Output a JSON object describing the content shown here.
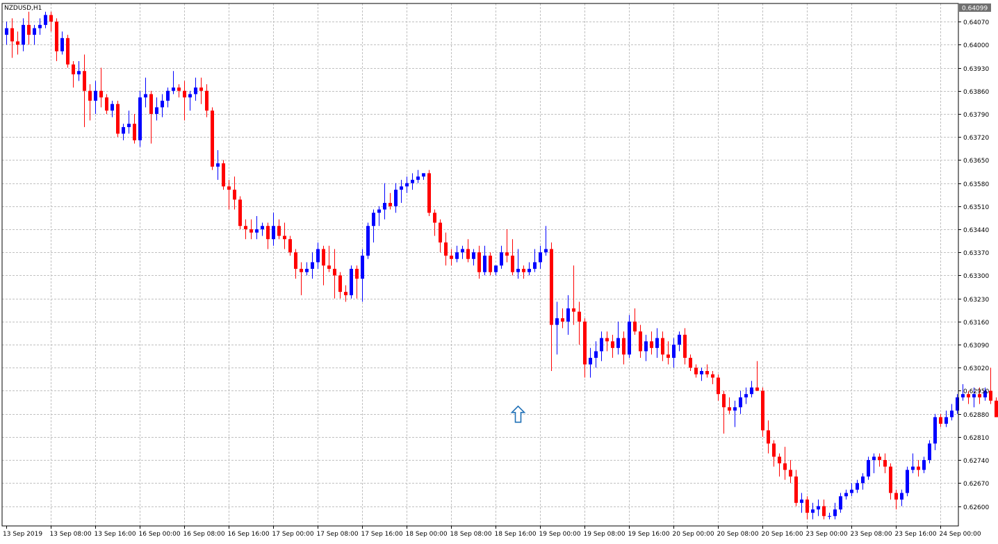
{
  "symbol_label": "NZDUSD,H1",
  "colors": {
    "bull": "#0000ff",
    "bear": "#ff0000",
    "grid": "#c0c0c0",
    "frame": "#000000",
    "background": "#ffffff",
    "price_tag_bg": "#707070",
    "arrow": "#1e6fb6"
  },
  "current_price_label": "0.64099",
  "arrow_icon": "up-arrow-icon",
  "chart_data": {
    "type": "candlestick",
    "symbol": "NZDUSD",
    "timeframe": "H1",
    "ylim": [
      0.6254,
      0.64125
    ],
    "grid": true,
    "y_ticks": [
      0.6407,
      0.64,
      0.6393,
      0.6386,
      0.6379,
      0.6372,
      0.6365,
      0.6358,
      0.6351,
      0.6344,
      0.6337,
      0.633,
      0.6323,
      0.6316,
      0.6309,
      0.6302,
      0.6295,
      0.6288,
      0.6281,
      0.6274,
      0.6267,
      0.626
    ],
    "y_tick_labels": [
      "0.64070",
      "0.64000",
      "0.63930",
      "0.63860",
      "0.63790",
      "0.63720",
      "0.63650",
      "0.63580",
      "0.63510",
      "0.63440",
      "0.63370",
      "0.63300",
      "0.63230",
      "0.63160",
      "0.63090",
      "0.63020",
      "0.62950",
      "0.62880",
      "0.62810",
      "0.62740",
      "0.62670",
      "0.62600"
    ],
    "x_tick_labels": [
      {
        "bar": 0,
        "label": "13 Sep 2019"
      },
      {
        "bar": 8,
        "label": "13 Sep 08:00"
      },
      {
        "bar": 16,
        "label": "13 Sep 16:00"
      },
      {
        "bar": 24,
        "label": "16 Sep 00:00"
      },
      {
        "bar": 32,
        "label": "16 Sep 08:00"
      },
      {
        "bar": 40,
        "label": "16 Sep 16:00"
      },
      {
        "bar": 48,
        "label": "17 Sep 00:00"
      },
      {
        "bar": 56,
        "label": "17 Sep 08:00"
      },
      {
        "bar": 64,
        "label": "17 Sep 16:00"
      },
      {
        "bar": 72,
        "label": "18 Sep 00:00"
      },
      {
        "bar": 80,
        "label": "18 Sep 08:00"
      },
      {
        "bar": 88,
        "label": "18 Sep 16:00"
      },
      {
        "bar": 96,
        "label": "19 Sep 00:00"
      },
      {
        "bar": 104,
        "label": "19 Sep 08:00"
      },
      {
        "bar": 112,
        "label": "19 Sep 16:00"
      },
      {
        "bar": 120,
        "label": "20 Sep 00:00"
      },
      {
        "bar": 128,
        "label": "20 Sep 08:00"
      },
      {
        "bar": 136,
        "label": "20 Sep 16:00"
      },
      {
        "bar": 144,
        "label": "23 Sep 00:00"
      },
      {
        "bar": 152,
        "label": "23 Sep 08:00"
      },
      {
        "bar": 160,
        "label": "23 Sep 16:00"
      },
      {
        "bar": 168,
        "label": "24 Sep 00:00"
      }
    ],
    "arrow_bar": 92,
    "arrow_price": 0.6288,
    "ohlc": [
      [
        0.6403,
        0.6407,
        0.64,
        0.6405
      ],
      [
        0.6405,
        0.6408,
        0.6396,
        0.6401
      ],
      [
        0.6401,
        0.6404,
        0.6397,
        0.64
      ],
      [
        0.64,
        0.6408,
        0.6398,
        0.6406
      ],
      [
        0.6406,
        0.641,
        0.64,
        0.6403
      ],
      [
        0.6403,
        0.6406,
        0.64,
        0.6405
      ],
      [
        0.6405,
        0.6408,
        0.6403,
        0.6406
      ],
      [
        0.6406,
        0.641,
        0.6405,
        0.6409
      ],
      [
        0.6409,
        0.641,
        0.6404,
        0.6407
      ],
      [
        0.6407,
        0.6408,
        0.6395,
        0.6398
      ],
      [
        0.6398,
        0.6404,
        0.6397,
        0.6402
      ],
      [
        0.6402,
        0.6403,
        0.6393,
        0.6394
      ],
      [
        0.6394,
        0.6395,
        0.6387,
        0.6391
      ],
      [
        0.6391,
        0.6395,
        0.6389,
        0.6392
      ],
      [
        0.6392,
        0.6397,
        0.6375,
        0.6386
      ],
      [
        0.6386,
        0.6388,
        0.6377,
        0.6383
      ],
      [
        0.6383,
        0.6389,
        0.6379,
        0.6386
      ],
      [
        0.6386,
        0.6393,
        0.6381,
        0.6384
      ],
      [
        0.6384,
        0.6385,
        0.6379,
        0.638
      ],
      [
        0.638,
        0.6383,
        0.6378,
        0.6382
      ],
      [
        0.6382,
        0.6383,
        0.6372,
        0.6373
      ],
      [
        0.6373,
        0.6376,
        0.6371,
        0.6375
      ],
      [
        0.6375,
        0.638,
        0.6373,
        0.6376
      ],
      [
        0.6376,
        0.6379,
        0.637,
        0.6371
      ],
      [
        0.6371,
        0.6386,
        0.6369,
        0.6384
      ],
      [
        0.6384,
        0.639,
        0.6381,
        0.6385
      ],
      [
        0.6385,
        0.6386,
        0.637,
        0.6379
      ],
      [
        0.6379,
        0.6384,
        0.6377,
        0.6381
      ],
      [
        0.6381,
        0.6385,
        0.6378,
        0.6383
      ],
      [
        0.6383,
        0.6387,
        0.6381,
        0.6386
      ],
      [
        0.6386,
        0.6392,
        0.6385,
        0.6387
      ],
      [
        0.6387,
        0.6388,
        0.6384,
        0.6386
      ],
      [
        0.6386,
        0.6389,
        0.6377,
        0.6384
      ],
      [
        0.6384,
        0.6386,
        0.638,
        0.6385
      ],
      [
        0.6385,
        0.639,
        0.6383,
        0.6387
      ],
      [
        0.6387,
        0.639,
        0.6382,
        0.6386
      ],
      [
        0.6386,
        0.6388,
        0.6378,
        0.638
      ],
      [
        0.638,
        0.6381,
        0.6362,
        0.6363
      ],
      [
        0.6363,
        0.6368,
        0.6359,
        0.6364
      ],
      [
        0.6364,
        0.6365,
        0.6356,
        0.6357
      ],
      [
        0.6357,
        0.6359,
        0.635,
        0.6356
      ],
      [
        0.6356,
        0.636,
        0.635,
        0.6353
      ],
      [
        0.6353,
        0.6354,
        0.6344,
        0.6345
      ],
      [
        0.6345,
        0.6347,
        0.6341,
        0.6344
      ],
      [
        0.6344,
        0.6347,
        0.6341,
        0.6343
      ],
      [
        0.6343,
        0.6348,
        0.6341,
        0.6344
      ],
      [
        0.6344,
        0.6346,
        0.6342,
        0.6345
      ],
      [
        0.6345,
        0.6346,
        0.6338,
        0.6341
      ],
      [
        0.6341,
        0.6349,
        0.6339,
        0.6345
      ],
      [
        0.6345,
        0.6347,
        0.6341,
        0.6342
      ],
      [
        0.6342,
        0.6346,
        0.6338,
        0.6341
      ],
      [
        0.6341,
        0.6342,
        0.6336,
        0.6337
      ],
      [
        0.6337,
        0.6338,
        0.6329,
        0.6332
      ],
      [
        0.6332,
        0.6334,
        0.6324,
        0.6331
      ],
      [
        0.6331,
        0.6334,
        0.633,
        0.6332
      ],
      [
        0.6332,
        0.6337,
        0.6329,
        0.6334
      ],
      [
        0.6334,
        0.634,
        0.6332,
        0.6338
      ],
      [
        0.6338,
        0.6339,
        0.6327,
        0.6333
      ],
      [
        0.6333,
        0.6339,
        0.6331,
        0.6332
      ],
      [
        0.6332,
        0.6338,
        0.6323,
        0.633
      ],
      [
        0.633,
        0.6331,
        0.6323,
        0.6325
      ],
      [
        0.6325,
        0.6327,
        0.6322,
        0.6324
      ],
      [
        0.6324,
        0.6333,
        0.6323,
        0.6332
      ],
      [
        0.6332,
        0.6333,
        0.6323,
        0.6329
      ],
      [
        0.6329,
        0.6338,
        0.6322,
        0.6336
      ],
      [
        0.6336,
        0.6346,
        0.6335,
        0.6345
      ],
      [
        0.6345,
        0.635,
        0.634,
        0.6349
      ],
      [
        0.6349,
        0.6351,
        0.6345,
        0.635
      ],
      [
        0.635,
        0.6358,
        0.6347,
        0.6352
      ],
      [
        0.6352,
        0.6355,
        0.635,
        0.6351
      ],
      [
        0.6351,
        0.6358,
        0.6349,
        0.6356
      ],
      [
        0.6356,
        0.6359,
        0.6352,
        0.6357
      ],
      [
        0.6357,
        0.636,
        0.6355,
        0.6358
      ],
      [
        0.6358,
        0.6361,
        0.6356,
        0.6359
      ],
      [
        0.6359,
        0.6362,
        0.6358,
        0.636
      ],
      [
        0.636,
        0.6361,
        0.6359,
        0.6361
      ],
      [
        0.6361,
        0.6362,
        0.6348,
        0.6349
      ],
      [
        0.6349,
        0.635,
        0.6342,
        0.6346
      ],
      [
        0.6346,
        0.6347,
        0.6337,
        0.634
      ],
      [
        0.634,
        0.6343,
        0.6333,
        0.6336
      ],
      [
        0.6336,
        0.6338,
        0.6333,
        0.6335
      ],
      [
        0.6335,
        0.6339,
        0.6334,
        0.6337
      ],
      [
        0.6337,
        0.6339,
        0.6335,
        0.6338
      ],
      [
        0.6338,
        0.6341,
        0.6334,
        0.6335
      ],
      [
        0.6335,
        0.6338,
        0.6333,
        0.6337
      ],
      [
        0.6337,
        0.6339,
        0.6329,
        0.6331
      ],
      [
        0.6331,
        0.6339,
        0.633,
        0.6336
      ],
      [
        0.6336,
        0.6337,
        0.633,
        0.6331
      ],
      [
        0.6331,
        0.6333,
        0.633,
        0.6333
      ],
      [
        0.6333,
        0.6339,
        0.6332,
        0.6337
      ],
      [
        0.6337,
        0.6344,
        0.6334,
        0.6336
      ],
      [
        0.6336,
        0.6341,
        0.633,
        0.6331
      ],
      [
        0.6331,
        0.6338,
        0.6329,
        0.6332
      ],
      [
        0.6332,
        0.6333,
        0.6329,
        0.6331
      ],
      [
        0.6331,
        0.6334,
        0.633,
        0.6332
      ],
      [
        0.6332,
        0.6338,
        0.6331,
        0.6334
      ],
      [
        0.6334,
        0.6339,
        0.6332,
        0.6337
      ],
      [
        0.6337,
        0.6345,
        0.6336,
        0.6338
      ],
      [
        0.6338,
        0.634,
        0.6301,
        0.6315
      ],
      [
        0.6315,
        0.6322,
        0.6306,
        0.6317
      ],
      [
        0.6317,
        0.632,
        0.6314,
        0.6316
      ],
      [
        0.6316,
        0.6324,
        0.6312,
        0.632
      ],
      [
        0.632,
        0.6333,
        0.6315,
        0.6319
      ],
      [
        0.6319,
        0.6322,
        0.6309,
        0.6316
      ],
      [
        0.6316,
        0.6317,
        0.6299,
        0.6303
      ],
      [
        0.6303,
        0.6308,
        0.6299,
        0.6305
      ],
      [
        0.6305,
        0.631,
        0.6302,
        0.6307
      ],
      [
        0.6307,
        0.6313,
        0.6304,
        0.6311
      ],
      [
        0.6311,
        0.6313,
        0.6307,
        0.631
      ],
      [
        0.631,
        0.6312,
        0.6305,
        0.6308
      ],
      [
        0.6308,
        0.6316,
        0.6306,
        0.6311
      ],
      [
        0.6311,
        0.6313,
        0.6303,
        0.6306
      ],
      [
        0.6306,
        0.6318,
        0.6305,
        0.6316
      ],
      [
        0.6316,
        0.632,
        0.6312,
        0.6313
      ],
      [
        0.6313,
        0.6315,
        0.6305,
        0.6307
      ],
      [
        0.6307,
        0.6312,
        0.6304,
        0.631
      ],
      [
        0.631,
        0.6313,
        0.6306,
        0.6308
      ],
      [
        0.6308,
        0.6314,
        0.6305,
        0.6311
      ],
      [
        0.6311,
        0.6313,
        0.6304,
        0.6306
      ],
      [
        0.6306,
        0.631,
        0.6303,
        0.6305
      ],
      [
        0.6305,
        0.6311,
        0.6302,
        0.6309
      ],
      [
        0.6309,
        0.6313,
        0.6307,
        0.6312
      ],
      [
        0.6312,
        0.6314,
        0.6303,
        0.6305
      ],
      [
        0.6305,
        0.6306,
        0.6301,
        0.6302
      ],
      [
        0.6302,
        0.6303,
        0.6299,
        0.63
      ],
      [
        0.63,
        0.6302,
        0.6298,
        0.6301
      ],
      [
        0.6301,
        0.6303,
        0.6299,
        0.63
      ],
      [
        0.63,
        0.6301,
        0.6297,
        0.6299
      ],
      [
        0.6299,
        0.63,
        0.6292,
        0.6294
      ],
      [
        0.6294,
        0.6295,
        0.6282,
        0.629
      ],
      [
        0.629,
        0.6293,
        0.6288,
        0.6289
      ],
      [
        0.6289,
        0.6292,
        0.6284,
        0.629
      ],
      [
        0.629,
        0.6295,
        0.6288,
        0.6293
      ],
      [
        0.6293,
        0.6296,
        0.6291,
        0.6294
      ],
      [
        0.6294,
        0.6298,
        0.6293,
        0.6296
      ],
      [
        0.6296,
        0.6304,
        0.6295,
        0.6295
      ],
      [
        0.6295,
        0.6296,
        0.6281,
        0.6283
      ],
      [
        0.6283,
        0.6286,
        0.6276,
        0.6279
      ],
      [
        0.6279,
        0.628,
        0.6272,
        0.6275
      ],
      [
        0.6275,
        0.6276,
        0.6269,
        0.6273
      ],
      [
        0.6273,
        0.6278,
        0.6268,
        0.6271
      ],
      [
        0.6271,
        0.6274,
        0.6267,
        0.6269
      ],
      [
        0.6269,
        0.6271,
        0.626,
        0.6261
      ],
      [
        0.6261,
        0.6264,
        0.6258,
        0.6262
      ],
      [
        0.6262,
        0.6263,
        0.6256,
        0.6258
      ],
      [
        0.6258,
        0.6261,
        0.6256,
        0.6259
      ],
      [
        0.6259,
        0.6262,
        0.6257,
        0.626
      ],
      [
        0.626,
        0.6262,
        0.6256,
        0.6257
      ],
      [
        0.6257,
        0.6258,
        0.6256,
        0.6257
      ],
      [
        0.6257,
        0.6261,
        0.6256,
        0.6259
      ],
      [
        0.6259,
        0.6264,
        0.6258,
        0.6263
      ],
      [
        0.6263,
        0.6265,
        0.6262,
        0.6264
      ],
      [
        0.6264,
        0.6267,
        0.6263,
        0.6265
      ],
      [
        0.6265,
        0.6268,
        0.6264,
        0.6267
      ],
      [
        0.6267,
        0.627,
        0.6265,
        0.6269
      ],
      [
        0.6269,
        0.6275,
        0.6268,
        0.6274
      ],
      [
        0.6274,
        0.6276,
        0.627,
        0.6275
      ],
      [
        0.6275,
        0.6276,
        0.6272,
        0.6274
      ],
      [
        0.6274,
        0.6276,
        0.627,
        0.6272
      ],
      [
        0.6272,
        0.6273,
        0.6262,
        0.6264
      ],
      [
        0.6264,
        0.6265,
        0.6259,
        0.6262
      ],
      [
        0.6262,
        0.6265,
        0.626,
        0.6264
      ],
      [
        0.6264,
        0.6272,
        0.6263,
        0.6271
      ],
      [
        0.6271,
        0.6276,
        0.627,
        0.6272
      ],
      [
        0.6272,
        0.6274,
        0.6269,
        0.6271
      ],
      [
        0.6271,
        0.6275,
        0.627,
        0.6274
      ],
      [
        0.6274,
        0.628,
        0.6273,
        0.6279
      ],
      [
        0.6279,
        0.6288,
        0.6277,
        0.6287
      ],
      [
        0.6287,
        0.6288,
        0.6284,
        0.6285
      ],
      [
        0.6285,
        0.6289,
        0.6284,
        0.6287
      ],
      [
        0.6287,
        0.6291,
        0.6286,
        0.6289
      ],
      [
        0.6289,
        0.6294,
        0.6288,
        0.6293
      ],
      [
        0.6293,
        0.6297,
        0.6292,
        0.6294
      ],
      [
        0.6294,
        0.6295,
        0.6291,
        0.6293
      ],
      [
        0.6293,
        0.6296,
        0.629,
        0.6294
      ],
      [
        0.6294,
        0.6296,
        0.6291,
        0.6293
      ],
      [
        0.6293,
        0.6296,
        0.6292,
        0.6295
      ],
      [
        0.6295,
        0.6302,
        0.6291,
        0.6292
      ],
      [
        0.6292,
        0.6293,
        0.6287,
        0.6287
      ]
    ]
  }
}
